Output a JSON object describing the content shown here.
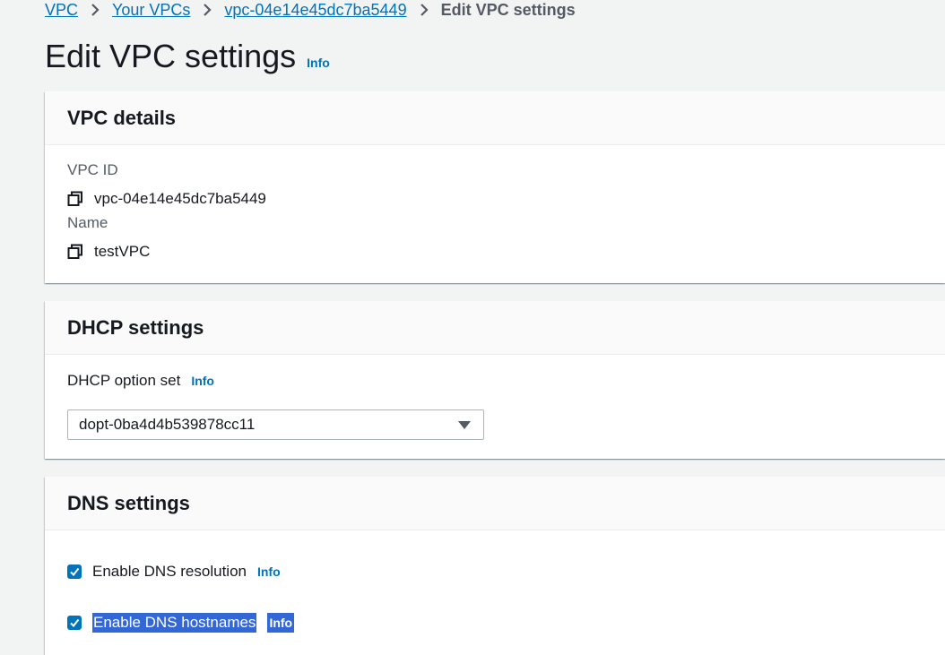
{
  "breadcrumb": {
    "items": [
      "VPC",
      "Your VPCs",
      "vpc-04e14e45dc7ba5449"
    ],
    "current": "Edit VPC settings"
  },
  "page": {
    "title": "Edit VPC settings",
    "info": "Info"
  },
  "vpc_details": {
    "title": "VPC details",
    "vpc_id_label": "VPC ID",
    "vpc_id_value": "vpc-04e14e45dc7ba5449",
    "name_label": "Name",
    "name_value": "testVPC"
  },
  "dhcp_settings": {
    "title": "DHCP settings",
    "option_set_label": "DHCP option set",
    "info": "Info",
    "selected_value": "dopt-0ba4d4b539878cc11"
  },
  "dns_settings": {
    "title": "DNS settings",
    "resolution_label": "Enable DNS resolution",
    "resolution_info": "Info",
    "resolution_checked": true,
    "hostnames_label": "Enable DNS hostnames",
    "hostnames_info": "Info",
    "hostnames_checked": true
  },
  "colors": {
    "link": "#0073bb",
    "checkbox": "#0073bb",
    "selection": "#3367d6"
  }
}
